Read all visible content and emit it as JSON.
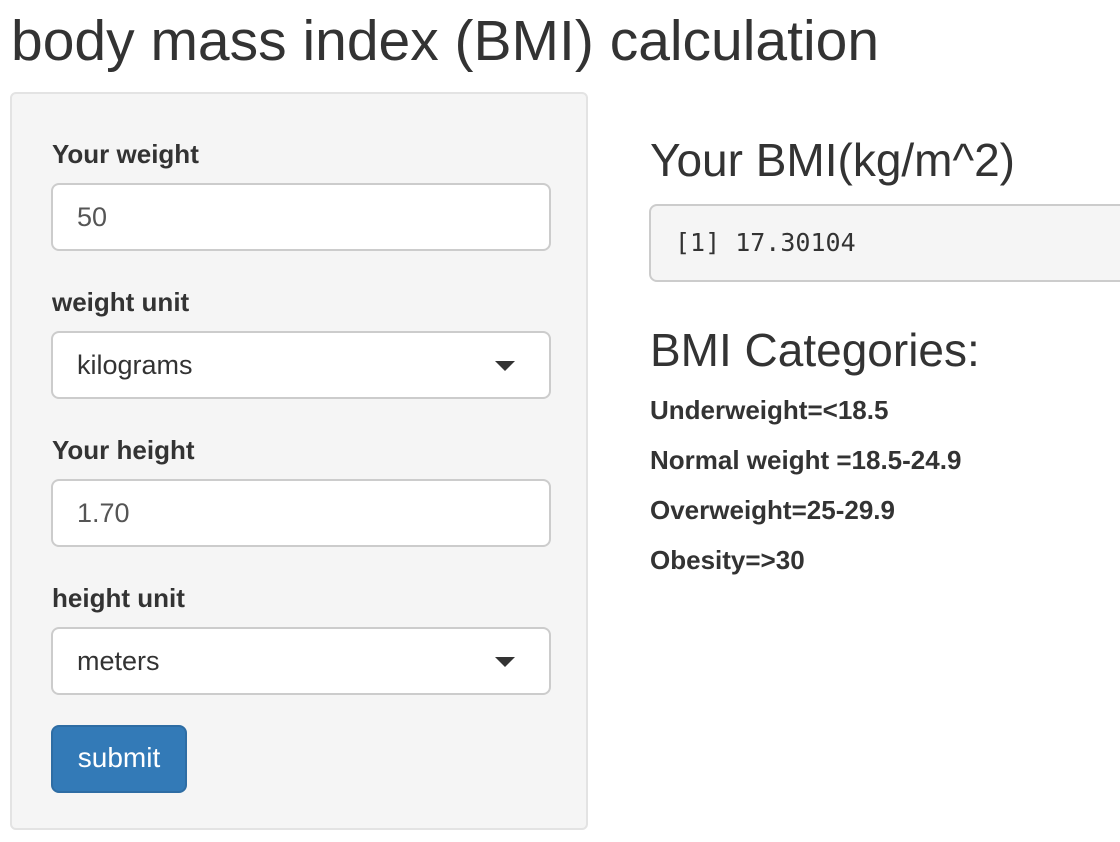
{
  "page": {
    "title": "body mass index (BMI) calculation"
  },
  "form": {
    "weight": {
      "label": "Your weight",
      "value": "50"
    },
    "weight_unit": {
      "label": "weight unit",
      "selected": "kilograms"
    },
    "height": {
      "label": "Your height",
      "value": "1.70"
    },
    "height_unit": {
      "label": "height unit",
      "selected": "meters"
    },
    "submit_label": "submit"
  },
  "result": {
    "title": "Your BMI(kg/m^2)",
    "output": "[1] 17.30104"
  },
  "categories": {
    "title": "BMI Categories:",
    "items": [
      "Underweight=<18.5",
      "Normal weight =18.5-24.9",
      "Overweight=25-29.9",
      "Obesity=>30"
    ]
  },
  "colors": {
    "button": "#337ab7",
    "panel": "#f5f5f5"
  }
}
